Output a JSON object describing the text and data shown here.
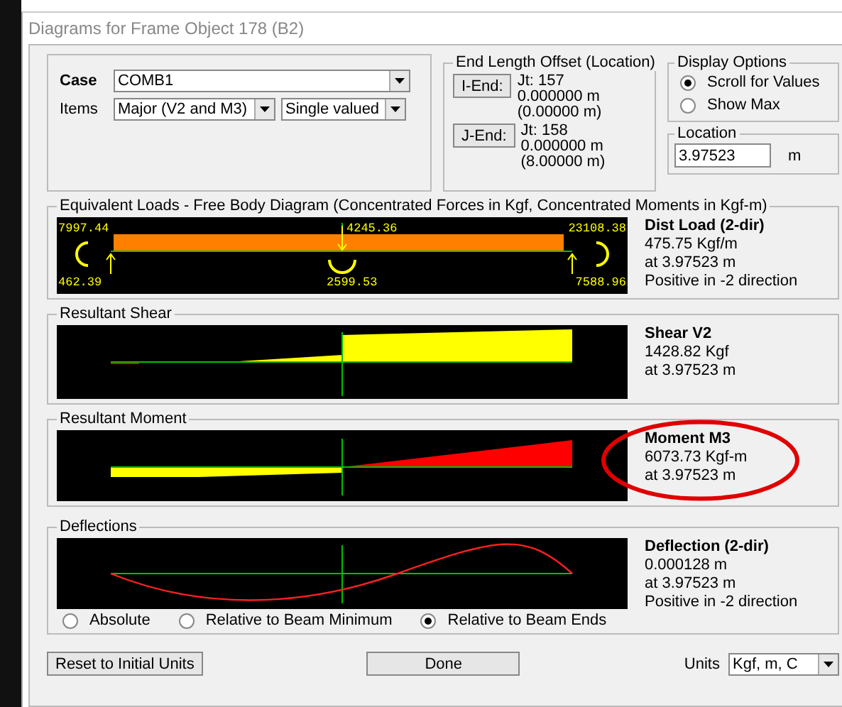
{
  "window": {
    "title": "Diagrams for Frame Object 178  (B2)"
  },
  "case": {
    "label": "Case",
    "value": "COMB1"
  },
  "items": {
    "label": "Items",
    "value": "Major (V2 and M3)",
    "mode": "Single valued"
  },
  "end_offset": {
    "title": "End Length Offset (Location)",
    "ends": [
      {
        "button": "I-End:",
        "joint": "Jt:  157",
        "offset": "0.000000 m",
        "location": "(0.00000 m)"
      },
      {
        "button": "J-End:",
        "joint": "Jt:  158",
        "offset": "0.000000 m",
        "location": "(8.00000 m)"
      }
    ]
  },
  "display_options": {
    "title": "Display Options",
    "options": [
      {
        "label": "Scroll for Values",
        "selected": true
      },
      {
        "label": "Show Max",
        "selected": false
      }
    ]
  },
  "location": {
    "title": "Location",
    "value": "3.97523",
    "unit": "m"
  },
  "panels": [
    {
      "kind": "loads",
      "title": "Equivalent Loads - Free Body Diagram  (Concentrated Forces in Kgf, Concentrated Moments in Kgf-m)",
      "labels": [
        "7997.44",
        "4245.36",
        "23108.38",
        "462.39",
        "2599.53",
        "7588.96"
      ],
      "heading": "Dist Load (2-dir)",
      "lines": [
        "475.75 Kgf/m",
        "at 3.97523 m",
        "Positive in -2 direction"
      ],
      "highlighted": false
    },
    {
      "kind": "shear",
      "title": "Resultant Shear",
      "heading": "Shear V2",
      "lines": [
        "1428.82 Kgf",
        "at 3.97523 m"
      ],
      "highlighted": false
    },
    {
      "kind": "moment",
      "title": "Resultant Moment",
      "heading": "Moment M3",
      "lines": [
        "6073.73 Kgf-m",
        "at 3.97523 m"
      ],
      "highlighted": true
    },
    {
      "kind": "deflection",
      "title": "Deflections",
      "heading": "Deflection (2-dir)",
      "lines": [
        "0.000128 m",
        "at 3.97523 m",
        "Positive in -2 direction"
      ],
      "highlighted": false,
      "modes": [
        {
          "label": "Absolute",
          "selected": false
        },
        {
          "label": "Relative to Beam Minimum",
          "selected": false
        },
        {
          "label": "Relative to Beam Ends",
          "selected": true
        }
      ]
    }
  ],
  "buttons": {
    "reset": "Reset to Initial Units",
    "done": "Done"
  },
  "units": {
    "label": "Units",
    "value": "Kgf, m, C"
  }
}
